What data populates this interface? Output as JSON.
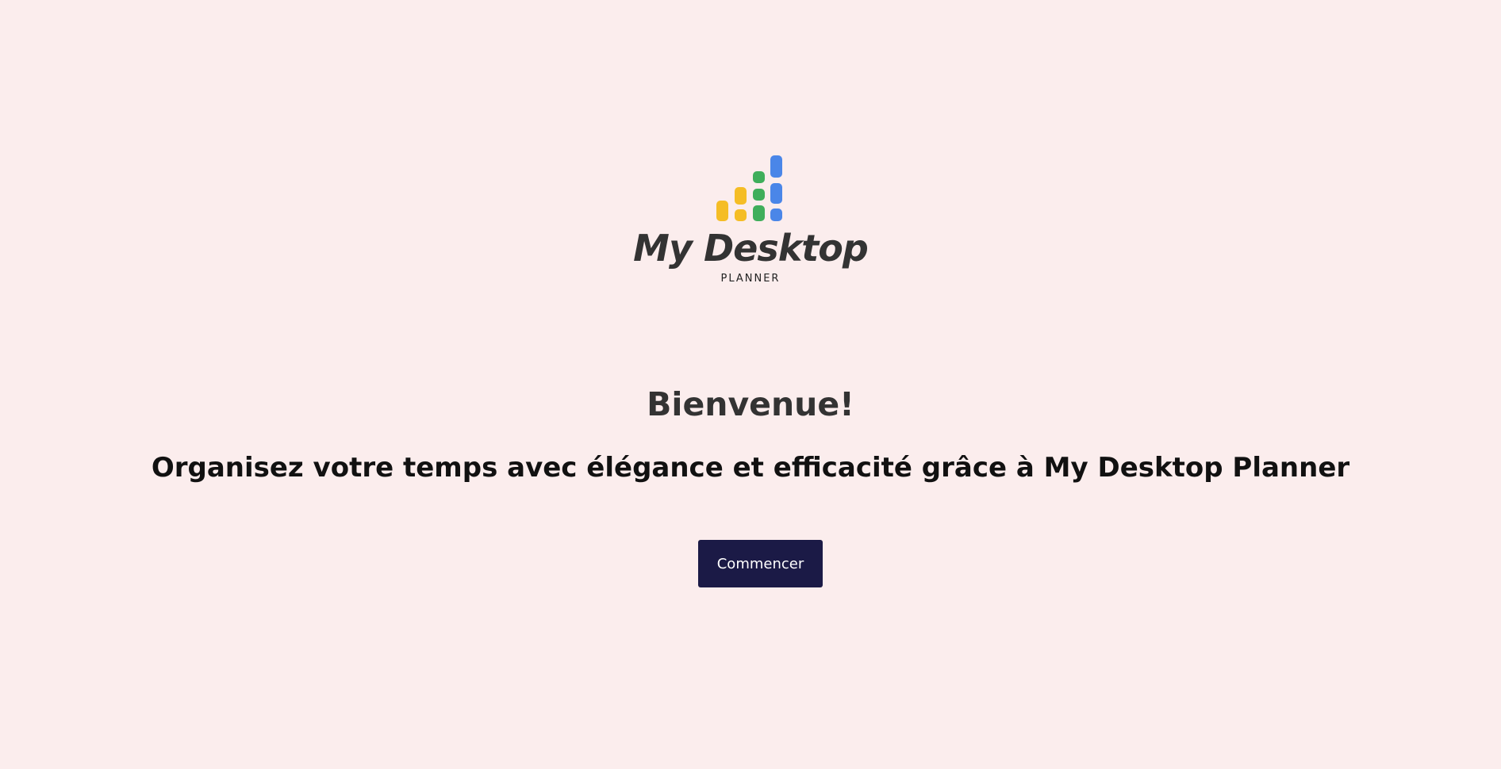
{
  "logo": {
    "title": "My Desktop",
    "subtitle": "PLANNER",
    "mark_icon": "bar-dots-logo-icon",
    "colors": {
      "yellow": "#f5bd25",
      "green": "#3fae5b",
      "blue": "#4a86e8"
    }
  },
  "hero": {
    "welcome": "Bienvenue!",
    "tagline": "Organisez votre temps avec élégance et efficacité grâce à My Desktop Planner"
  },
  "cta": {
    "label": "Commencer",
    "background": "#1b1a46"
  },
  "theme": {
    "background": "#fbeded"
  }
}
